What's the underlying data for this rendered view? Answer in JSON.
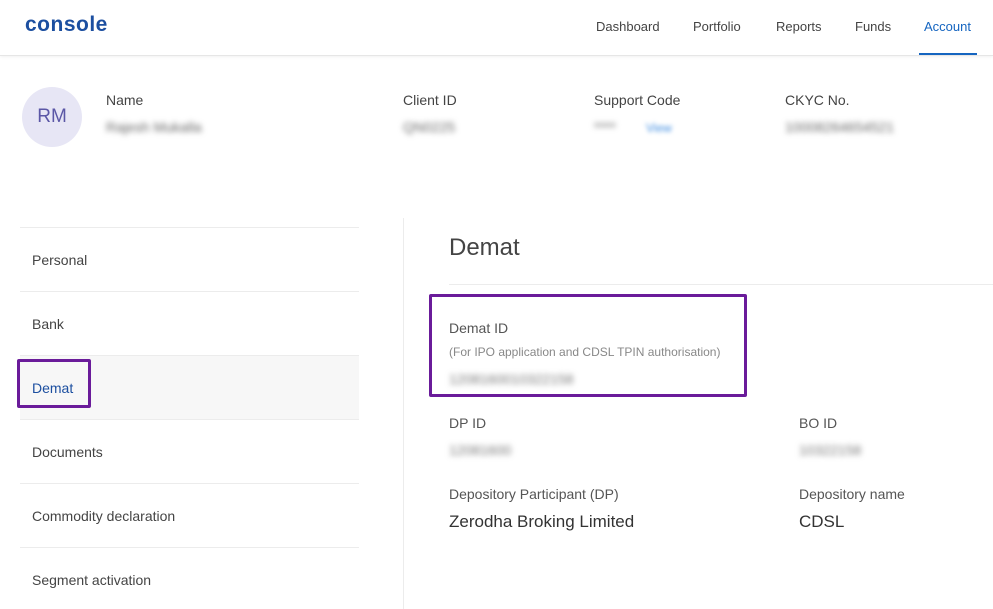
{
  "app": {
    "logo": "console"
  },
  "nav": {
    "items": [
      "Dashboard",
      "Portfolio",
      "Reports",
      "Funds",
      "Account"
    ],
    "active": "Account"
  },
  "profile": {
    "initials": "RM",
    "name_label": "Name",
    "name_value": "Rajesh Mukalla",
    "client_id_label": "Client ID",
    "client_id_value": "QN0225",
    "support_code_label": "Support Code",
    "support_code_value": "****",
    "support_code_link": "View",
    "ckyc_label": "CKYC No.",
    "ckyc_value": "10008264654521"
  },
  "sidebar": {
    "items": [
      "Personal",
      "Bank",
      "Demat",
      "Documents",
      "Commodity declaration",
      "Segment activation"
    ],
    "selected": "Demat"
  },
  "demat": {
    "title": "Demat",
    "demat_id_label": "Demat ID",
    "demat_id_note": "(For IPO application and CDSL TPIN authorisation)",
    "demat_id_value": "1208160010322158",
    "dp_id_label": "DP ID",
    "dp_id_value": "12081600",
    "bo_id_label": "BO ID",
    "bo_id_value": "10322158",
    "dp_name_label": "Depository Participant (DP)",
    "dp_name_value": "Zerodha Broking Limited",
    "depository_label": "Depository name",
    "depository_value": "CDSL"
  },
  "colors": {
    "brand": "#1c4fa0",
    "active_nav": "#1565c0",
    "highlight": "#6a1b9a",
    "avatar_bg": "#e7e6f5"
  }
}
